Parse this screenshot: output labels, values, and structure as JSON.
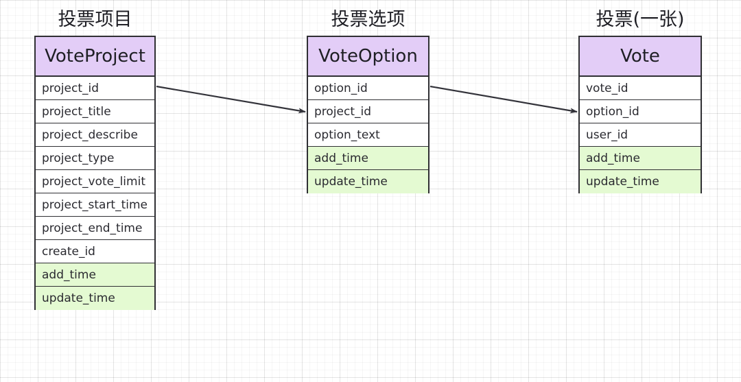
{
  "diagram": {
    "type": "entity-relationship-diagram",
    "background": "graph-paper-grid",
    "colors": {
      "header_fill": "#e3cdf7",
      "timestamp_fill": "#e4fad2",
      "plain_fill": "#ffffff",
      "border": "#2f2f33",
      "text": "#1f1f25",
      "arrow": "#33333a"
    },
    "entities": [
      {
        "caption": "投票项目",
        "name": "VoteProject",
        "fields": [
          {
            "label": "project_id",
            "highlight": "none"
          },
          {
            "label": "project_title",
            "highlight": "none"
          },
          {
            "label": "project_describe",
            "highlight": "none"
          },
          {
            "label": "project_type",
            "highlight": "none"
          },
          {
            "label": "project_vote_limit",
            "highlight": "none"
          },
          {
            "label": "project_start_time",
            "highlight": "none"
          },
          {
            "label": "project_end_time",
            "highlight": "none"
          },
          {
            "label": "create_id",
            "highlight": "none"
          },
          {
            "label": "add_time",
            "highlight": "green"
          },
          {
            "label": "update_time",
            "highlight": "green"
          }
        ]
      },
      {
        "caption": "投票选项",
        "name": "VoteOption",
        "fields": [
          {
            "label": "option_id",
            "highlight": "none"
          },
          {
            "label": "project_id",
            "highlight": "none"
          },
          {
            "label": "option_text",
            "highlight": "none"
          },
          {
            "label": "add_time",
            "highlight": "green"
          },
          {
            "label": "update_time",
            "highlight": "green"
          }
        ]
      },
      {
        "caption": "投票(一张)",
        "name": "Vote",
        "fields": [
          {
            "label": "vote_id",
            "highlight": "none"
          },
          {
            "label": "option_id",
            "highlight": "none"
          },
          {
            "label": "user_id",
            "highlight": "none"
          },
          {
            "label": "add_time",
            "highlight": "green"
          },
          {
            "label": "update_time",
            "highlight": "green"
          }
        ]
      }
    ],
    "relations": [
      {
        "name": "voteproject-to-voteoption",
        "from_entity": "VoteProject",
        "from_field": "project_id",
        "to_entity": "VoteOption",
        "to_field": "project_id"
      },
      {
        "name": "voteoption-to-vote",
        "from_entity": "VoteOption",
        "from_field": "option_id",
        "to_entity": "Vote",
        "to_field": "option_id"
      }
    ]
  }
}
